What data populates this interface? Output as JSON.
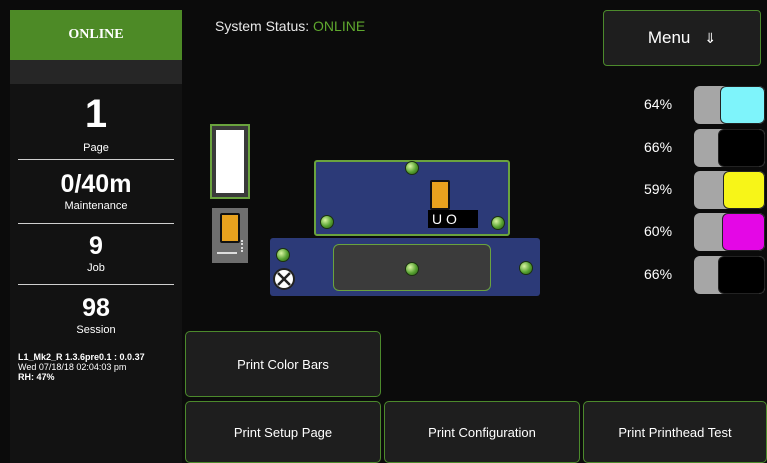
{
  "sidebar": {
    "status": "ONLINE",
    "stats": [
      {
        "value": "1",
        "label": "Page"
      },
      {
        "value": "0/40m",
        "label": "Maintenance"
      },
      {
        "value": "9",
        "label": "Job"
      },
      {
        "value": "98",
        "label": "Session"
      }
    ],
    "version": "L1_Mk2_R 1.3.6pre0.1 : 0.0.37",
    "datetime": "Wed 07/18/18 02:04:03 pm",
    "humidity": "RH: 47%"
  },
  "header": {
    "status_prefix": "System Status:",
    "status_value": "ONLINE",
    "menu_label": "Menu",
    "menu_icon": "⇓"
  },
  "head_base_text": "U O",
  "ink_levels": [
    {
      "percent": "64%",
      "level": 0.64,
      "color": "#7ef4fb",
      "name": "cyan"
    },
    {
      "percent": "66%",
      "level": 0.66,
      "color": "#000000",
      "name": "black"
    },
    {
      "percent": "59%",
      "level": 0.59,
      "color": "#f7f518",
      "name": "yellow"
    },
    {
      "percent": "60%",
      "level": 0.6,
      "color": "#e407e6",
      "name": "magenta"
    },
    {
      "percent": "66%",
      "level": 0.66,
      "color": "#000000",
      "name": "black"
    }
  ],
  "actions": {
    "color_bars": "Print Color Bars",
    "setup_page": "Print Setup Page",
    "configuration": "Print Configuration",
    "printhead_test": "Print Printhead Test"
  },
  "colors": {
    "accent": "#4d8a26",
    "status_ok": "#5fa82e",
    "plate": "#2c3a78",
    "cartridge": "#e8a21e"
  }
}
